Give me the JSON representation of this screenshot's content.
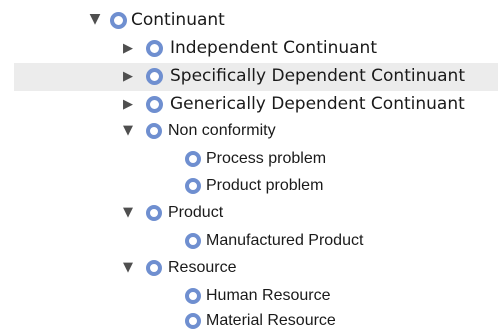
{
  "tree": {
    "nodes": [
      {
        "label": "Continuant",
        "toggle": "▼",
        "icon": "class-circle-icon"
      },
      {
        "label": "Independent Continuant",
        "toggle": "▶",
        "icon": "class-circle-icon"
      },
      {
        "label": "Specifically Dependent Continuant",
        "toggle": "▶",
        "icon": "class-circle-icon",
        "selected": true
      },
      {
        "label": "Generically Dependent Continuant",
        "toggle": "▶",
        "icon": "class-circle-icon"
      },
      {
        "label": "Non conformity",
        "toggle": "▼",
        "icon": "class-circle-icon"
      },
      {
        "label": "Process problem",
        "toggle": "",
        "icon": "class-circle-icon"
      },
      {
        "label": "Product problem",
        "toggle": "",
        "icon": "class-circle-icon"
      },
      {
        "label": "Product",
        "toggle": "▼",
        "icon": "class-circle-icon"
      },
      {
        "label": "Manufactured Product",
        "toggle": "",
        "icon": "class-circle-icon"
      },
      {
        "label": "Resource",
        "toggle": "▼",
        "icon": "class-circle-icon"
      },
      {
        "label": "Human Resource",
        "toggle": "",
        "icon": "class-circle-icon"
      },
      {
        "label": "Material Resource",
        "toggle": "",
        "icon": "class-circle-icon"
      }
    ]
  },
  "colors": {
    "icon_ring": "#6f8fd0",
    "selection_background": "#ececec",
    "text": "#1a1a1a"
  }
}
